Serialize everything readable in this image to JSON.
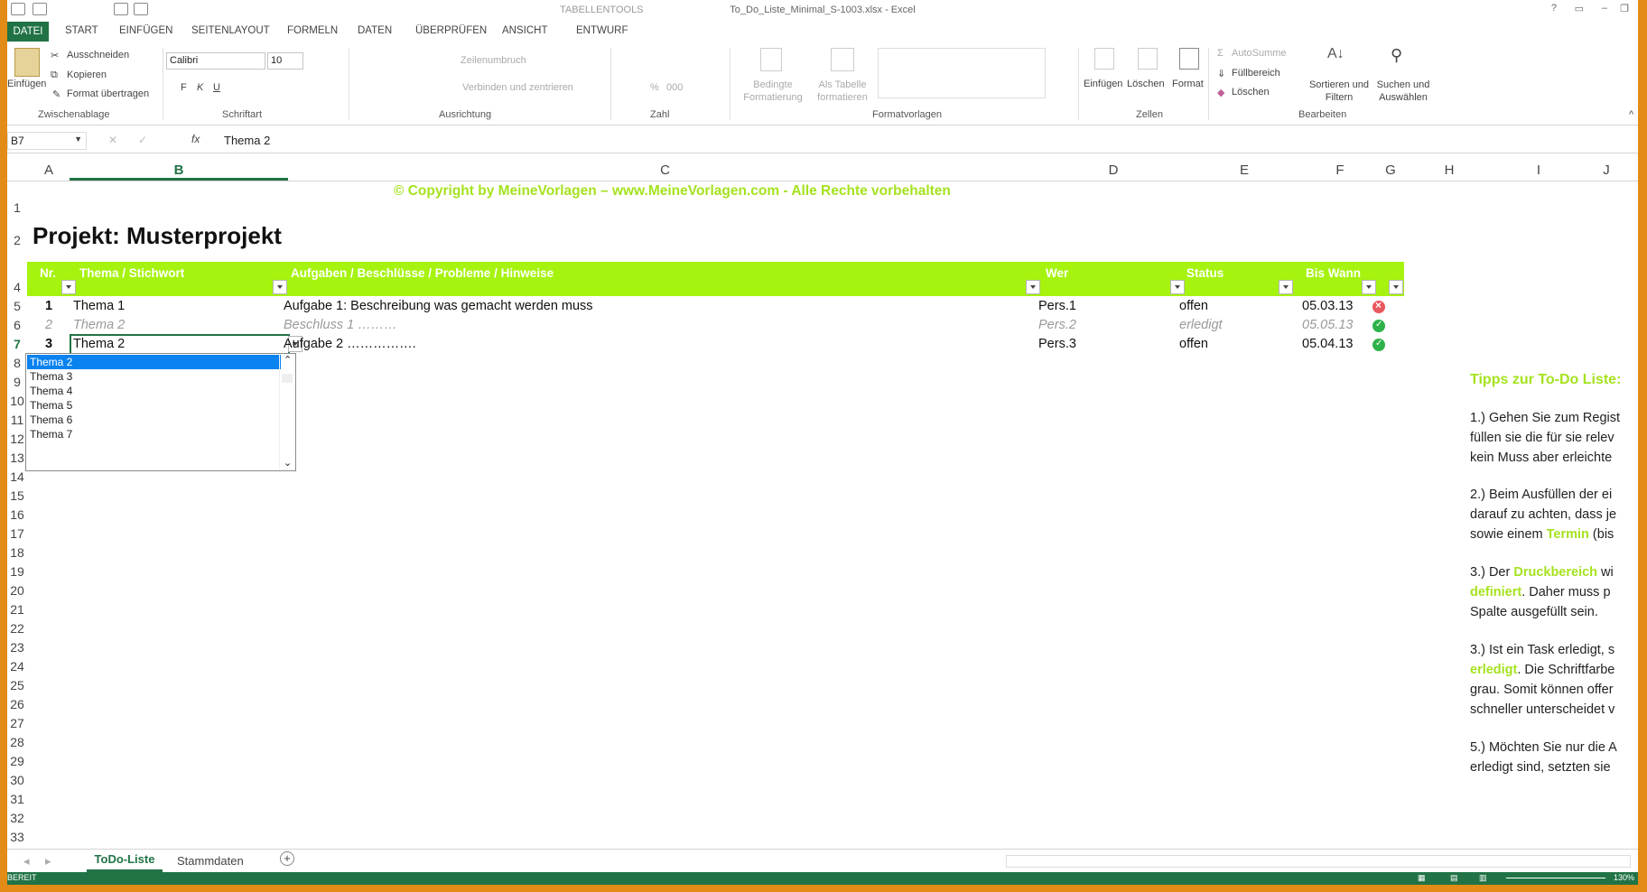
{
  "window": {
    "title": "To_Do_Liste_Minimal_S-1003.xlsx - Excel",
    "context_tab": "TABELLENTOOLS"
  },
  "ribbon_tabs": [
    "DATEI",
    "START",
    "EINFÜGEN",
    "SEITENLAYOUT",
    "FORMELN",
    "DATEN",
    "ÜBERPRÜFEN",
    "ANSICHT",
    "ENTWURF"
  ],
  "ribbon": {
    "clipboard": {
      "paste": "Einfügen",
      "cut": "Ausschneiden",
      "copy": "Kopieren",
      "format_painter": "Format übertragen",
      "group": "Zwischenablage"
    },
    "font": {
      "name": "Calibri",
      "size": "10",
      "group": "Schriftart",
      "bold": "F",
      "italic": "K",
      "underline": "U"
    },
    "alignment": {
      "wrap": "Zeilenumbruch",
      "merge": "Verbinden und zentrieren",
      "group": "Ausrichtung"
    },
    "number": {
      "group": "Zahl",
      "percent": "%",
      "thousands": "000"
    },
    "styles": {
      "conditional": "Bedingte Formatierung",
      "as_table": "Als Tabelle formatieren",
      "group": "Formatvorlagen"
    },
    "cells": {
      "insert": "Einfügen",
      "delete": "Löschen",
      "format": "Format",
      "group": "Zellen"
    },
    "editing": {
      "autosum": "AutoSumme",
      "fill": "Füllbereich",
      "clear": "Löschen",
      "sort": "Sortieren und Filtern",
      "find": "Suchen und Auswählen",
      "group": "Bearbeiten"
    }
  },
  "formula_bar": {
    "name_box": "B7",
    "fx": "fx",
    "value": "Thema 2"
  },
  "columns": [
    "A",
    "B",
    "C",
    "D",
    "E",
    "F",
    "G",
    "H",
    "I",
    "J"
  ],
  "rows": [
    "1",
    "2",
    "4",
    "5",
    "6",
    "7",
    "8",
    "9",
    "10",
    "11",
    "12",
    "13",
    "14",
    "15",
    "16",
    "17",
    "18",
    "19",
    "20",
    "21",
    "22",
    "23",
    "24",
    "25",
    "26",
    "27",
    "28",
    "29",
    "30",
    "31",
    "32",
    "33"
  ],
  "copyright": "© Copyright by MeineVorlagen – www.MeineVorlagen.com - Alle Rechte vorbehalten",
  "project_title": "Projekt: Musterprojekt",
  "table": {
    "headers": [
      "Nr.",
      "Thema / Stichwort",
      "Aufgaben / Beschlüsse / Probleme / Hinweise",
      "Wer",
      "Status",
      "Bis Wann"
    ],
    "rows": [
      {
        "nr": "1",
        "thema": "Thema 1",
        "aufgabe": "Aufgabe 1:  Beschreibung  was gemacht werden muss",
        "wer": "Pers.1",
        "status": "offen",
        "bis": "05.03.13",
        "icon": "cross-circle-icon",
        "done": false
      },
      {
        "nr": "2",
        "thema": "Thema 2",
        "aufgabe": "Beschluss 1 ………",
        "wer": "Pers.2",
        "status": "erledigt",
        "bis": "05.05.13",
        "icon": "check-circle-icon",
        "done": true
      },
      {
        "nr": "3",
        "thema": "Thema 2",
        "aufgabe": "Aufgabe 2 …………….",
        "wer": "Pers.3",
        "status": "offen",
        "bis": "05.04.13",
        "icon": "check-circle-icon",
        "done": false
      }
    ]
  },
  "dropdown": {
    "items": [
      "Thema 2",
      "Thema 3",
      "Thema 4",
      "Thema 5",
      "Thema 6",
      "Thema 7"
    ],
    "selected": "Thema 2"
  },
  "tips": {
    "heading": "Tipps zur To-Do Liste:",
    "t1_l1": "1.) Gehen Sie zum Regist",
    "t1_l2": "füllen sie die für sie relev",
    "t1_l3": "kein Muss aber erleichte",
    "t2_l1": "2.) Beim Ausfüllen der ei",
    "t2_l2": "darauf zu achten, dass je",
    "t2_l3a": "sowie einem ",
    "t2_l3b": "Termin",
    "t2_l3c": " (bis",
    "t3_l1a": "3.) Der ",
    "t3_l1b": "Druckbereich",
    "t3_l1c": " wi",
    "t3_l2a": "definiert",
    "t3_l2b": ". Daher muss p",
    "t3_l3": "Spalte ausgefüllt sein.",
    "t4_l1": "3.) Ist ein Task erledigt, s",
    "t4_l2a": "erledigt",
    "t4_l2b": ". Die Schriftfarbe",
    "t4_l3": "grau. Somit können offer",
    "t4_l4": "schneller unterscheidet v",
    "t5_l1": "5.) Möchten Sie nur die A",
    "t5_l2": "erledigt sind, setzten sie"
  },
  "sheet_tabs": {
    "active": "ToDo-Liste",
    "other": "Stammdaten",
    "add": "+"
  },
  "status_bar": {
    "mode": "BEREIT",
    "zoom": "130%"
  },
  "colors": {
    "accent": "#a6f30f",
    "excel_green": "#217346",
    "frame": "#e28b16",
    "selection": "#0a82f0"
  }
}
